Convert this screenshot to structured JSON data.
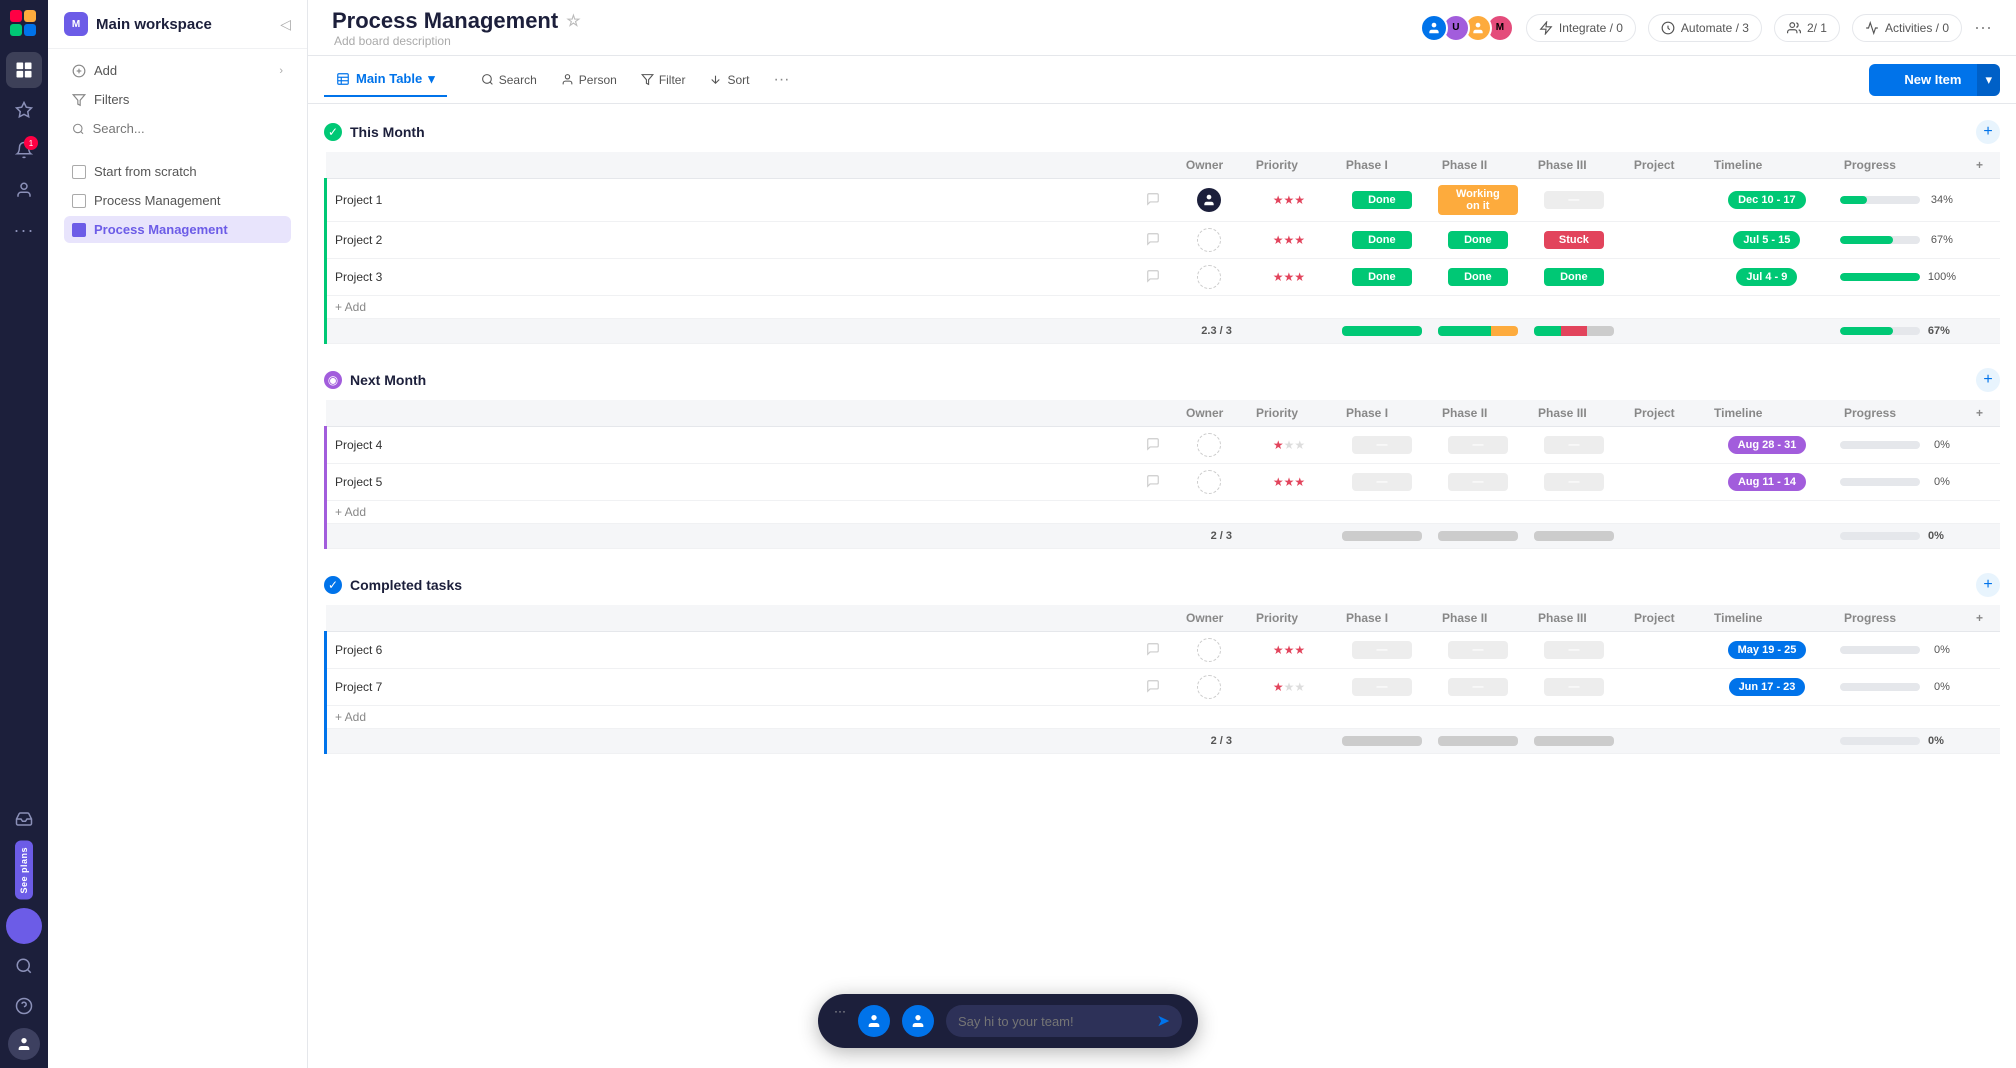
{
  "app": {
    "logo": "🟥🟧",
    "rail_icons": [
      "grid",
      "star",
      "bell",
      "user",
      "download"
    ],
    "see_plans": "See plans"
  },
  "sidebar": {
    "workspace_name": "Main workspace",
    "ws_initial": "M",
    "actions": [
      {
        "id": "add",
        "label": "Add",
        "icon": "+"
      },
      {
        "id": "filters",
        "label": "Filters",
        "icon": "≡"
      }
    ],
    "search_placeholder": "Search...",
    "nav_items": [
      {
        "id": "start-from-scratch",
        "label": "Start from scratch",
        "active": false
      },
      {
        "id": "process-management-1",
        "label": "Process Management",
        "active": false
      },
      {
        "id": "process-management-2",
        "label": "Process Management",
        "active": true
      }
    ]
  },
  "header": {
    "board_title": "Process Management",
    "board_desc": "Add board description",
    "integrate_label": "Integrate / 0",
    "automate_label": "Automate / 3",
    "activities_label": "Activities / 0",
    "invite_label": "2/ 1"
  },
  "toolbar": {
    "main_table_label": "Main Table",
    "new_item_label": "New Item",
    "search_label": "Search",
    "person_label": "Person",
    "filter_label": "Filter",
    "sort_label": "Sort"
  },
  "groups": [
    {
      "id": "this-month",
      "title": "This Month",
      "color": "green",
      "columns": [
        "Owner",
        "Priority",
        "Phase I",
        "Phase II",
        "Phase III",
        "Project",
        "Timeline",
        "Progress"
      ],
      "rows": [
        {
          "id": "project-1",
          "name": "Project 1",
          "owner": "user",
          "priority": 3,
          "priority_max": 5,
          "phase1": "Done",
          "phase1_status": "done",
          "phase2": "Working on it",
          "phase2_status": "working",
          "phase3": "",
          "phase3_status": "empty",
          "project": "",
          "timeline": "Dec 10 - 17",
          "timeline_color": "green",
          "progress": 34
        },
        {
          "id": "project-2",
          "name": "Project 2",
          "owner": "empty",
          "priority": 3,
          "priority_max": 5,
          "phase1": "Done",
          "phase1_status": "done",
          "phase2": "Done",
          "phase2_status": "done",
          "phase3": "Stuck",
          "phase3_status": "stuck",
          "project": "",
          "timeline": "Jul 5 - 15",
          "timeline_color": "green",
          "progress": 67
        },
        {
          "id": "project-3",
          "name": "Project 3",
          "owner": "empty",
          "priority": 3,
          "priority_max": 3,
          "phase1": "Done",
          "phase1_status": "done",
          "phase2": "Done",
          "phase2_status": "done",
          "phase3": "Done",
          "phase3_status": "done",
          "project": "",
          "timeline": "Jul 4 - 9",
          "timeline_color": "green",
          "progress": 100
        }
      ],
      "summary_priority": "2.3 / 3",
      "summary_progress": 67
    },
    {
      "id": "next-month",
      "title": "Next Month",
      "color": "purple",
      "columns": [
        "Owner",
        "Priority",
        "Phase I",
        "Phase II",
        "Phase III",
        "Project",
        "Timeline",
        "Progress"
      ],
      "rows": [
        {
          "id": "project-4",
          "name": "Project 4",
          "owner": "empty",
          "priority": 1,
          "priority_max": 3,
          "phase1": "",
          "phase1_status": "empty",
          "phase2": "",
          "phase2_status": "empty",
          "phase3": "",
          "phase3_status": "empty",
          "project": "",
          "timeline": "Aug 28 - 31",
          "timeline_color": "purple",
          "progress": 0
        },
        {
          "id": "project-5",
          "name": "Project 5",
          "owner": "empty",
          "priority": 3,
          "priority_max": 3,
          "phase1": "",
          "phase1_status": "empty",
          "phase2": "",
          "phase2_status": "empty",
          "phase3": "",
          "phase3_status": "empty",
          "project": "",
          "timeline": "Aug 11 - 14",
          "timeline_color": "purple",
          "progress": 0
        }
      ],
      "summary_priority": "2 / 3",
      "summary_progress": 0
    },
    {
      "id": "completed-tasks",
      "title": "Completed tasks",
      "color": "blue",
      "columns": [
        "Owner",
        "Priority",
        "Phase I",
        "Phase II",
        "Phase III",
        "Project",
        "Timeline",
        "Progress"
      ],
      "rows": [
        {
          "id": "project-6",
          "name": "Project 6",
          "owner": "empty",
          "priority": 3,
          "priority_max": 3,
          "phase1": "",
          "phase1_status": "empty",
          "phase2": "",
          "phase2_status": "empty",
          "phase3": "",
          "phase3_status": "empty",
          "project": "",
          "timeline": "May 19 - 25",
          "timeline_color": "blue",
          "progress": 0
        },
        {
          "id": "project-7",
          "name": "Project 7",
          "owner": "empty",
          "priority": 1,
          "priority_max": 3,
          "phase1": "",
          "phase1_status": "empty",
          "phase2": "",
          "phase2_status": "empty",
          "phase3": "",
          "phase3_status": "empty",
          "project": "",
          "timeline": "Jun 17 - 23",
          "timeline_color": "blue",
          "progress": 0
        }
      ],
      "summary_priority": "2 / 3",
      "summary_progress": 0
    }
  ],
  "chat": {
    "placeholder": "Say hi to your team!",
    "send_icon": "➤",
    "more_icon": "···"
  },
  "icons": {
    "grid": "⊞",
    "star": "☆",
    "bell": "🔔",
    "user_plus": "👤",
    "download": "⬇",
    "search": "🔍",
    "filter": "≡",
    "sort": "↕",
    "person": "👤",
    "table": "⊞",
    "chevron_down": "▾",
    "plus": "+",
    "more": "···",
    "comment": "💬",
    "bolt": "⚡",
    "integrate": "⬡",
    "automate": "⚙"
  }
}
